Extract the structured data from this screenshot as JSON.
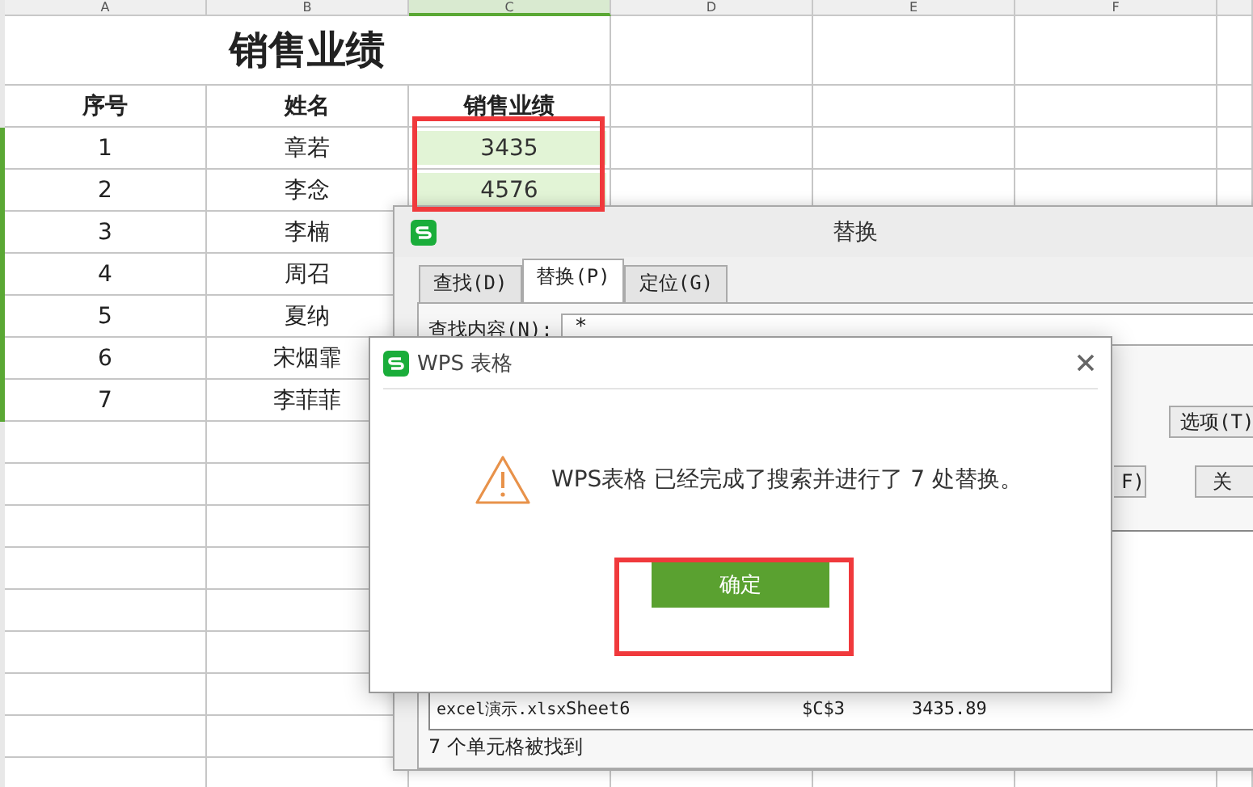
{
  "sheet": {
    "column_headers": [
      {
        "label": "A",
        "selected": false
      },
      {
        "label": "B",
        "selected": false
      },
      {
        "label": "C",
        "selected": true
      },
      {
        "label": "D",
        "selected": false
      },
      {
        "label": "E",
        "selected": false
      },
      {
        "label": "F",
        "selected": false
      }
    ],
    "title": "销售业绩",
    "header": [
      "序号",
      "姓名",
      "销售业绩"
    ],
    "rows": [
      {
        "no": "1",
        "name": "章若",
        "sales": "3435",
        "sales_selected": true
      },
      {
        "no": "2",
        "name": "李念",
        "sales": "4576",
        "sales_selected": true
      },
      {
        "no": "3",
        "name": "李楠"
      },
      {
        "no": "4",
        "name": "周召"
      },
      {
        "no": "5",
        "name": "夏纳"
      },
      {
        "no": "6",
        "name": "宋烟霏"
      },
      {
        "no": "7",
        "name": "李菲菲"
      }
    ]
  },
  "replace_dialog": {
    "title": "替换",
    "tabs": [
      {
        "label": "查找(D)",
        "selected": false
      },
      {
        "label": "替换(P)",
        "selected": true
      },
      {
        "label": "定位(G)",
        "selected": false
      }
    ],
    "find_label": "查找内容(N):",
    "find_value": "*",
    "options_button": "选项(T)",
    "partial_button": "F)",
    "close_button_partial": "关",
    "results": [
      {
        "file": "excel演示.xlsx",
        "sheet": "Sheet6",
        "cell": "$C$3",
        "value": "3435.89"
      }
    ],
    "status": "7 个单元格被找到"
  },
  "message_box": {
    "title": "WPS 表格",
    "message": "WPS表格 已经完成了搜索并进行了 7 处替换。",
    "ok_button": "确定"
  }
}
